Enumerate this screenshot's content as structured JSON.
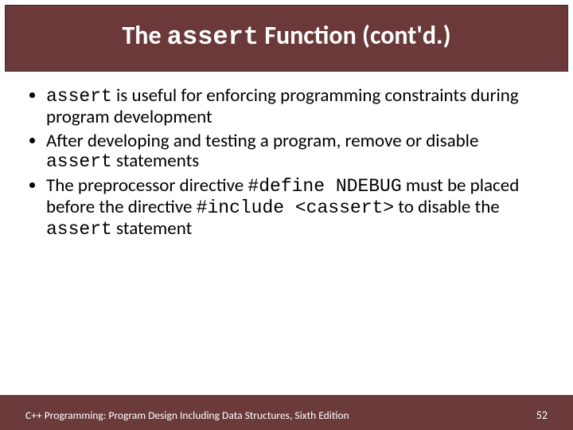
{
  "title": {
    "pre": "The ",
    "code": "assert",
    "post": " Function (cont'd.)"
  },
  "bullets": {
    "b1": {
      "code1": "assert",
      "t1": " is useful for enforcing programming constraints during program development"
    },
    "b2": {
      "t1": "After developing and testing a program, remove or disable ",
      "code1": "assert",
      "t2": " statements"
    },
    "b3": {
      "t1": "The preprocessor directive ",
      "code1": "#define NDEBUG",
      "t2": " must be placed before the directive ",
      "code2": "#include <cassert>",
      "t3": " to disable the ",
      "code3": "assert",
      "t4": " statement"
    }
  },
  "footer": {
    "text": "C++ Programming: Program Design Including Data Structures, Sixth Edition",
    "page": "52"
  }
}
